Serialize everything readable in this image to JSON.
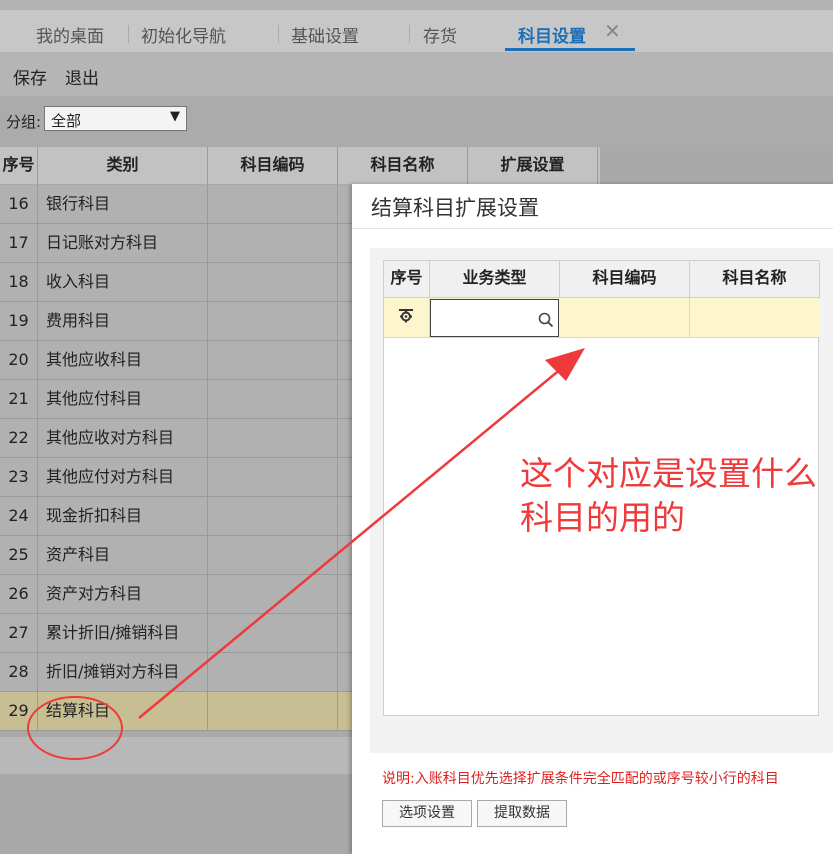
{
  "tabs": [
    {
      "label": "我的桌面"
    },
    {
      "label": "初始化导航"
    },
    {
      "label": "基础设置"
    },
    {
      "label": "存货"
    },
    {
      "label": "科目设置"
    }
  ],
  "tab_close": "✕",
  "toolbar": {
    "save": "保存",
    "exit": "退出"
  },
  "filter": {
    "label": "分组:",
    "value": "全部",
    "arrow": "▼"
  },
  "table": {
    "headers": {
      "idx": "序号",
      "category": "类别",
      "code": "科目编码",
      "name": "科目名称",
      "ext": "扩展设置"
    },
    "rows": [
      {
        "idx": "16",
        "category": "银行科目"
      },
      {
        "idx": "17",
        "category": "日记账对方科目"
      },
      {
        "idx": "18",
        "category": "收入科目"
      },
      {
        "idx": "19",
        "category": "费用科目"
      },
      {
        "idx": "20",
        "category": "其他应收科目"
      },
      {
        "idx": "21",
        "category": "其他应付科目"
      },
      {
        "idx": "22",
        "category": "其他应收对方科目"
      },
      {
        "idx": "23",
        "category": "其他应付对方科目"
      },
      {
        "idx": "24",
        "category": "现金折扣科目"
      },
      {
        "idx": "25",
        "category": "资产科目"
      },
      {
        "idx": "26",
        "category": "资产对方科目"
      },
      {
        "idx": "27",
        "category": "累计折旧/摊销科目"
      },
      {
        "idx": "28",
        "category": "折旧/摊销对方科目"
      },
      {
        "idx": "29",
        "category": "结算科目"
      }
    ]
  },
  "dialog": {
    "title": "结算科目扩展设置",
    "grid_headers": {
      "idx": "序号",
      "biz": "业务类型",
      "code": "科目编码",
      "name": "科目名称"
    },
    "note": "说明:入账科目优先选择扩展条件完全匹配的或序号较小行的科目",
    "buttons": {
      "options": "选项设置",
      "fetch": "提取数据"
    }
  },
  "annotation": {
    "text": "这个对应是设置什么科目的用的",
    "color": "#ee3a3a"
  },
  "colors": {
    "accent": "#1d6fb8",
    "note": "#e02020",
    "row_highlight": "#fdf6cc"
  }
}
